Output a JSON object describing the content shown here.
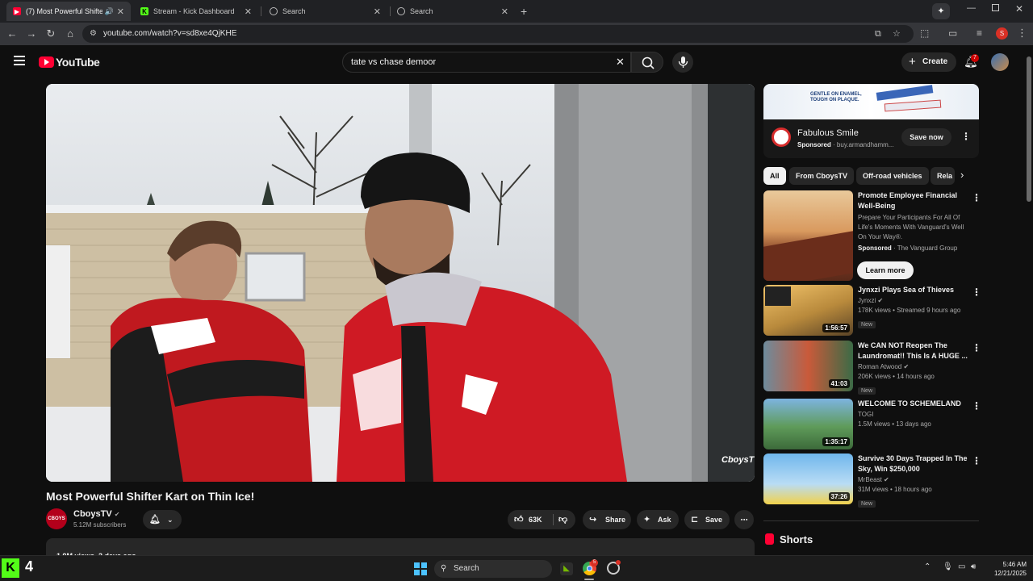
{
  "browser": {
    "tabs": [
      {
        "title": "(7) Most Powerful Shifter K",
        "active": true
      },
      {
        "title": "Stream - Kick Dashboard"
      },
      {
        "title": "Search"
      },
      {
        "title": "Search"
      }
    ],
    "url": "youtube.com/watch?v=sd8xe4QjKHE",
    "profile_initial": "S"
  },
  "youtube": {
    "logo": "YouTube",
    "search_value": "tate vs chase demoor",
    "create_label": "Create",
    "notif_count": "7"
  },
  "video": {
    "title": "Most Powerful Shifter Kart on Thin Ice!",
    "watermark": "CboysTV",
    "channel": "CboysTV",
    "channel_avatar": "CBOYS",
    "subscribers": "5.12M subscribers",
    "likes": "63K",
    "share": "Share",
    "ask": "Ask",
    "save": "Save",
    "views_line": "1.9M views  2 days ago"
  },
  "ad": {
    "banner_line1": "GENTLE ON ENAMEL,",
    "banner_line2": "TOUGH ON PLAQUE.",
    "title": "Fabulous Smile",
    "sponsored": "Sponsored",
    "domain": "buy.armandhamm...",
    "cta": "Save now"
  },
  "chips": [
    "All",
    "From CboysTV",
    "Off-road vehicles",
    "Rela"
  ],
  "recs": [
    {
      "title": "Promote Employee Financial Well-Being",
      "desc": "Prepare Your Participants For All Of Life's Moments With Vanguard's Well On Your Way®.",
      "sponsored": "Sponsored",
      "advertiser": "The Vanguard Group",
      "cta": "Learn more"
    },
    {
      "title": "Jynxzi Plays Sea of Thieves",
      "channel": "Jynxzi",
      "meta": "178K views • Streamed 9 hours ago",
      "badge": "New",
      "duration": "1:56:57"
    },
    {
      "title": "We CAN NOT Reopen The Laundromat!! This Is A HUGE ...",
      "channel": "Roman Atwood",
      "meta": "206K views • 14 hours ago",
      "badge": "New",
      "duration": "41:03"
    },
    {
      "title": "WELCOME TO SCHEMELAND",
      "channel": "TOGI",
      "meta": "1.5M views • 13 days ago",
      "duration": "1:35:17"
    },
    {
      "title": "Survive 30 Days Trapped In The Sky, Win $250,000",
      "channel": "MrBeast",
      "meta": "31M views • 18 hours ago",
      "badge": "New",
      "duration": "37:26"
    }
  ],
  "shorts_label": "Shorts",
  "taskbar": {
    "kick_count": "4",
    "search": "Search",
    "time": "5:46 AM",
    "date": "12/21/2025",
    "chrome_badge": "5"
  },
  "colors": {
    "yt_red": "#ff0033",
    "kick_green": "#53fc18",
    "bg": "#0f0f0f"
  }
}
